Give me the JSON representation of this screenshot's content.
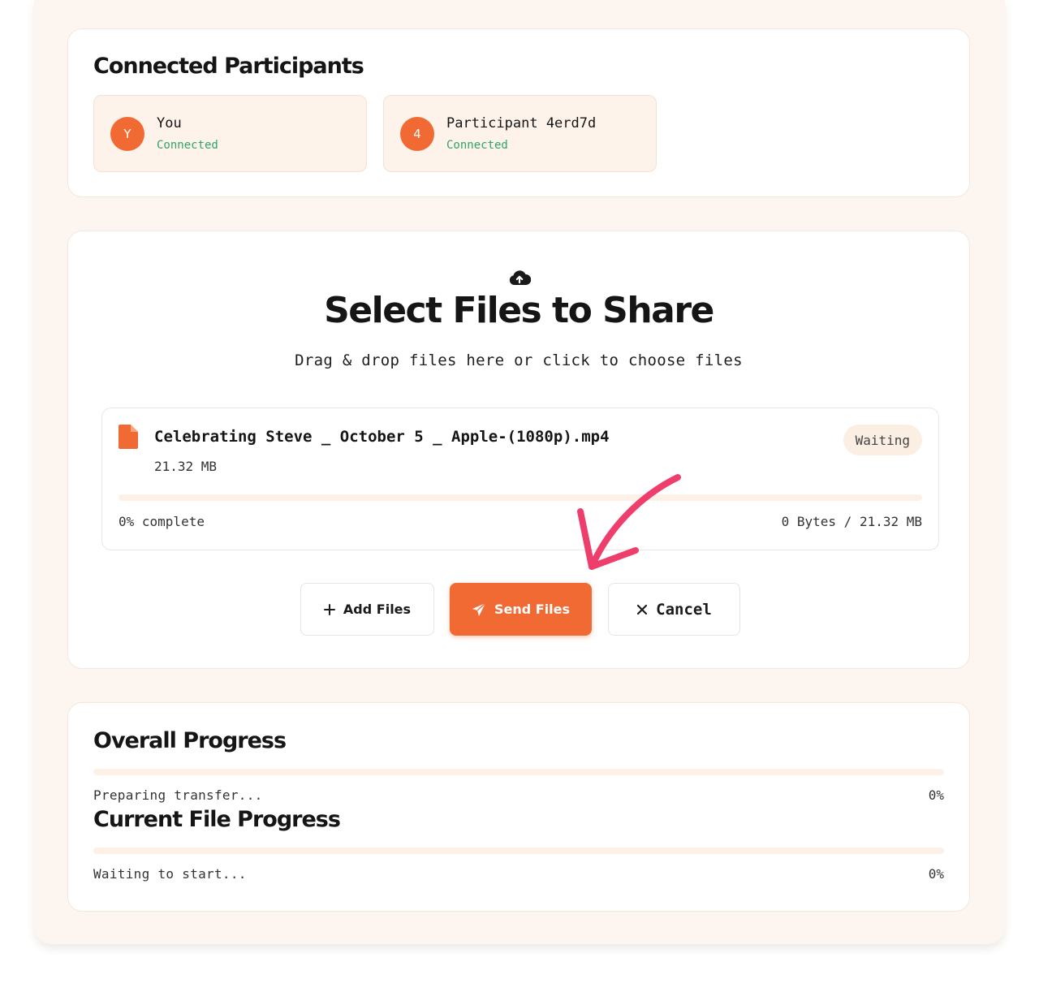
{
  "participants": {
    "title": "Connected Participants",
    "items": [
      {
        "initial": "Y",
        "name": "You",
        "status": "Connected"
      },
      {
        "initial": "4",
        "name": "Participant 4erd7d",
        "status": "Connected"
      }
    ]
  },
  "select": {
    "icon": "cloud-upload-icon",
    "title": "Select Files to Share",
    "subtitle": "Drag & drop files here or click to choose files",
    "file": {
      "icon": "file-icon",
      "name": "Celebrating Steve _ October 5 _ Apple-(1080p).mp4",
      "size": "21.32 MB",
      "status": "Waiting",
      "progress": 0,
      "progress_text": "0% complete",
      "bytes_text": "0 Bytes / 21.32 MB"
    },
    "buttons": {
      "add": "Add Files",
      "send": "Send Files",
      "cancel": "Cancel"
    }
  },
  "progress": {
    "overall": {
      "title": "Overall Progress",
      "status": "Preparing transfer...",
      "percent_text": "0%",
      "value": 0
    },
    "current": {
      "title": "Current File Progress",
      "status": "Waiting to start...",
      "percent_text": "0%",
      "value": 0
    }
  },
  "colors": {
    "accent": "#f26a33",
    "connected": "#2fa56a",
    "annotation": "#ee3f6c",
    "background": "#fdf6f0"
  }
}
